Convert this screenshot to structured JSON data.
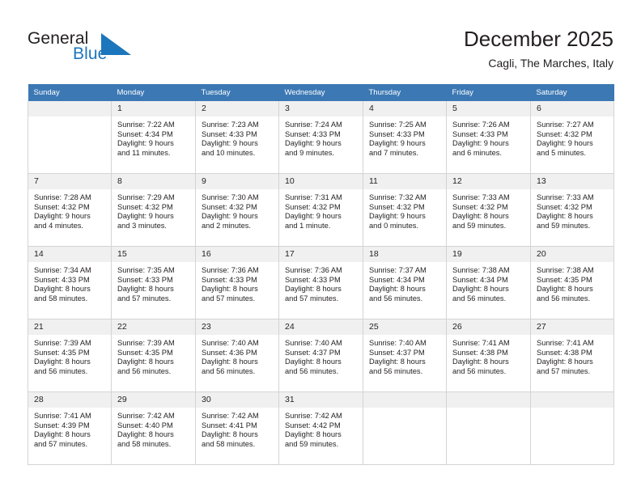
{
  "brand": {
    "name_part1": "General",
    "name_part2": "Blue",
    "accent_color": "#1b76bc",
    "logo_icon": "triangle-flag-icon"
  },
  "header": {
    "title": "December 2025",
    "subtitle": "Cagli, The Marches, Italy",
    "header_bg_color": "#3c78b4"
  },
  "weekdays": [
    "Sunday",
    "Monday",
    "Tuesday",
    "Wednesday",
    "Thursday",
    "Friday",
    "Saturday"
  ],
  "labels": {
    "sunrise_prefix": "Sunrise: ",
    "sunset_prefix": "Sunset: ",
    "daylight_prefix": "Daylight: "
  },
  "weeks": [
    [
      {
        "day": "",
        "sunrise": "",
        "sunset": "",
        "daylight_line1": "",
        "daylight_line2": ""
      },
      {
        "day": "1",
        "sunrise": "Sunrise: 7:22 AM",
        "sunset": "Sunset: 4:34 PM",
        "daylight_line1": "Daylight: 9 hours",
        "daylight_line2": "and 11 minutes."
      },
      {
        "day": "2",
        "sunrise": "Sunrise: 7:23 AM",
        "sunset": "Sunset: 4:33 PM",
        "daylight_line1": "Daylight: 9 hours",
        "daylight_line2": "and 10 minutes."
      },
      {
        "day": "3",
        "sunrise": "Sunrise: 7:24 AM",
        "sunset": "Sunset: 4:33 PM",
        "daylight_line1": "Daylight: 9 hours",
        "daylight_line2": "and 9 minutes."
      },
      {
        "day": "4",
        "sunrise": "Sunrise: 7:25 AM",
        "sunset": "Sunset: 4:33 PM",
        "daylight_line1": "Daylight: 9 hours",
        "daylight_line2": "and 7 minutes."
      },
      {
        "day": "5",
        "sunrise": "Sunrise: 7:26 AM",
        "sunset": "Sunset: 4:33 PM",
        "daylight_line1": "Daylight: 9 hours",
        "daylight_line2": "and 6 minutes."
      },
      {
        "day": "6",
        "sunrise": "Sunrise: 7:27 AM",
        "sunset": "Sunset: 4:32 PM",
        "daylight_line1": "Daylight: 9 hours",
        "daylight_line2": "and 5 minutes."
      }
    ],
    [
      {
        "day": "7",
        "sunrise": "Sunrise: 7:28 AM",
        "sunset": "Sunset: 4:32 PM",
        "daylight_line1": "Daylight: 9 hours",
        "daylight_line2": "and 4 minutes."
      },
      {
        "day": "8",
        "sunrise": "Sunrise: 7:29 AM",
        "sunset": "Sunset: 4:32 PM",
        "daylight_line1": "Daylight: 9 hours",
        "daylight_line2": "and 3 minutes."
      },
      {
        "day": "9",
        "sunrise": "Sunrise: 7:30 AM",
        "sunset": "Sunset: 4:32 PM",
        "daylight_line1": "Daylight: 9 hours",
        "daylight_line2": "and 2 minutes."
      },
      {
        "day": "10",
        "sunrise": "Sunrise: 7:31 AM",
        "sunset": "Sunset: 4:32 PM",
        "daylight_line1": "Daylight: 9 hours",
        "daylight_line2": "and 1 minute."
      },
      {
        "day": "11",
        "sunrise": "Sunrise: 7:32 AM",
        "sunset": "Sunset: 4:32 PM",
        "daylight_line1": "Daylight: 9 hours",
        "daylight_line2": "and 0 minutes."
      },
      {
        "day": "12",
        "sunrise": "Sunrise: 7:33 AM",
        "sunset": "Sunset: 4:32 PM",
        "daylight_line1": "Daylight: 8 hours",
        "daylight_line2": "and 59 minutes."
      },
      {
        "day": "13",
        "sunrise": "Sunrise: 7:33 AM",
        "sunset": "Sunset: 4:32 PM",
        "daylight_line1": "Daylight: 8 hours",
        "daylight_line2": "and 59 minutes."
      }
    ],
    [
      {
        "day": "14",
        "sunrise": "Sunrise: 7:34 AM",
        "sunset": "Sunset: 4:33 PM",
        "daylight_line1": "Daylight: 8 hours",
        "daylight_line2": "and 58 minutes."
      },
      {
        "day": "15",
        "sunrise": "Sunrise: 7:35 AM",
        "sunset": "Sunset: 4:33 PM",
        "daylight_line1": "Daylight: 8 hours",
        "daylight_line2": "and 57 minutes."
      },
      {
        "day": "16",
        "sunrise": "Sunrise: 7:36 AM",
        "sunset": "Sunset: 4:33 PM",
        "daylight_line1": "Daylight: 8 hours",
        "daylight_line2": "and 57 minutes."
      },
      {
        "day": "17",
        "sunrise": "Sunrise: 7:36 AM",
        "sunset": "Sunset: 4:33 PM",
        "daylight_line1": "Daylight: 8 hours",
        "daylight_line2": "and 57 minutes."
      },
      {
        "day": "18",
        "sunrise": "Sunrise: 7:37 AM",
        "sunset": "Sunset: 4:34 PM",
        "daylight_line1": "Daylight: 8 hours",
        "daylight_line2": "and 56 minutes."
      },
      {
        "day": "19",
        "sunrise": "Sunrise: 7:38 AM",
        "sunset": "Sunset: 4:34 PM",
        "daylight_line1": "Daylight: 8 hours",
        "daylight_line2": "and 56 minutes."
      },
      {
        "day": "20",
        "sunrise": "Sunrise: 7:38 AM",
        "sunset": "Sunset: 4:35 PM",
        "daylight_line1": "Daylight: 8 hours",
        "daylight_line2": "and 56 minutes."
      }
    ],
    [
      {
        "day": "21",
        "sunrise": "Sunrise: 7:39 AM",
        "sunset": "Sunset: 4:35 PM",
        "daylight_line1": "Daylight: 8 hours",
        "daylight_line2": "and 56 minutes."
      },
      {
        "day": "22",
        "sunrise": "Sunrise: 7:39 AM",
        "sunset": "Sunset: 4:35 PM",
        "daylight_line1": "Daylight: 8 hours",
        "daylight_line2": "and 56 minutes."
      },
      {
        "day": "23",
        "sunrise": "Sunrise: 7:40 AM",
        "sunset": "Sunset: 4:36 PM",
        "daylight_line1": "Daylight: 8 hours",
        "daylight_line2": "and 56 minutes."
      },
      {
        "day": "24",
        "sunrise": "Sunrise: 7:40 AM",
        "sunset": "Sunset: 4:37 PM",
        "daylight_line1": "Daylight: 8 hours",
        "daylight_line2": "and 56 minutes."
      },
      {
        "day": "25",
        "sunrise": "Sunrise: 7:40 AM",
        "sunset": "Sunset: 4:37 PM",
        "daylight_line1": "Daylight: 8 hours",
        "daylight_line2": "and 56 minutes."
      },
      {
        "day": "26",
        "sunrise": "Sunrise: 7:41 AM",
        "sunset": "Sunset: 4:38 PM",
        "daylight_line1": "Daylight: 8 hours",
        "daylight_line2": "and 56 minutes."
      },
      {
        "day": "27",
        "sunrise": "Sunrise: 7:41 AM",
        "sunset": "Sunset: 4:38 PM",
        "daylight_line1": "Daylight: 8 hours",
        "daylight_line2": "and 57 minutes."
      }
    ],
    [
      {
        "day": "28",
        "sunrise": "Sunrise: 7:41 AM",
        "sunset": "Sunset: 4:39 PM",
        "daylight_line1": "Daylight: 8 hours",
        "daylight_line2": "and 57 minutes."
      },
      {
        "day": "29",
        "sunrise": "Sunrise: 7:42 AM",
        "sunset": "Sunset: 4:40 PM",
        "daylight_line1": "Daylight: 8 hours",
        "daylight_line2": "and 58 minutes."
      },
      {
        "day": "30",
        "sunrise": "Sunrise: 7:42 AM",
        "sunset": "Sunset: 4:41 PM",
        "daylight_line1": "Daylight: 8 hours",
        "daylight_line2": "and 58 minutes."
      },
      {
        "day": "31",
        "sunrise": "Sunrise: 7:42 AM",
        "sunset": "Sunset: 4:42 PM",
        "daylight_line1": "Daylight: 8 hours",
        "daylight_line2": "and 59 minutes."
      },
      {
        "day": "",
        "sunrise": "",
        "sunset": "",
        "daylight_line1": "",
        "daylight_line2": ""
      },
      {
        "day": "",
        "sunrise": "",
        "sunset": "",
        "daylight_line1": "",
        "daylight_line2": ""
      },
      {
        "day": "",
        "sunrise": "",
        "sunset": "",
        "daylight_line1": "",
        "daylight_line2": ""
      }
    ]
  ]
}
